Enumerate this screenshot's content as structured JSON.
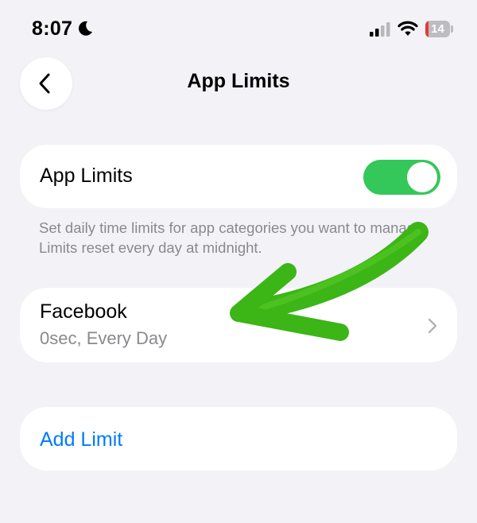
{
  "status_bar": {
    "time": "8:07",
    "focus_icon": "moon-icon",
    "battery": {
      "level": "14",
      "color": "#e53935",
      "fill_fraction": 0.14
    }
  },
  "nav": {
    "title": "App Limits",
    "back_icon": "chevron-left-icon"
  },
  "toggle_section": {
    "label": "App Limits",
    "enabled": true,
    "toggle_color": "#34c759"
  },
  "description": "Set daily time limits for app categories you want to manage. Limits reset every day at midnight.",
  "limits": [
    {
      "name": "Facebook",
      "detail": "0sec, Every Day",
      "icon": "chevron-right-icon"
    }
  ],
  "add_limit": {
    "label": "Add Limit",
    "color": "#007aff"
  },
  "annotation": {
    "type": "hand-drawn arrow",
    "color": "#3cb517",
    "points_to": "Facebook"
  }
}
